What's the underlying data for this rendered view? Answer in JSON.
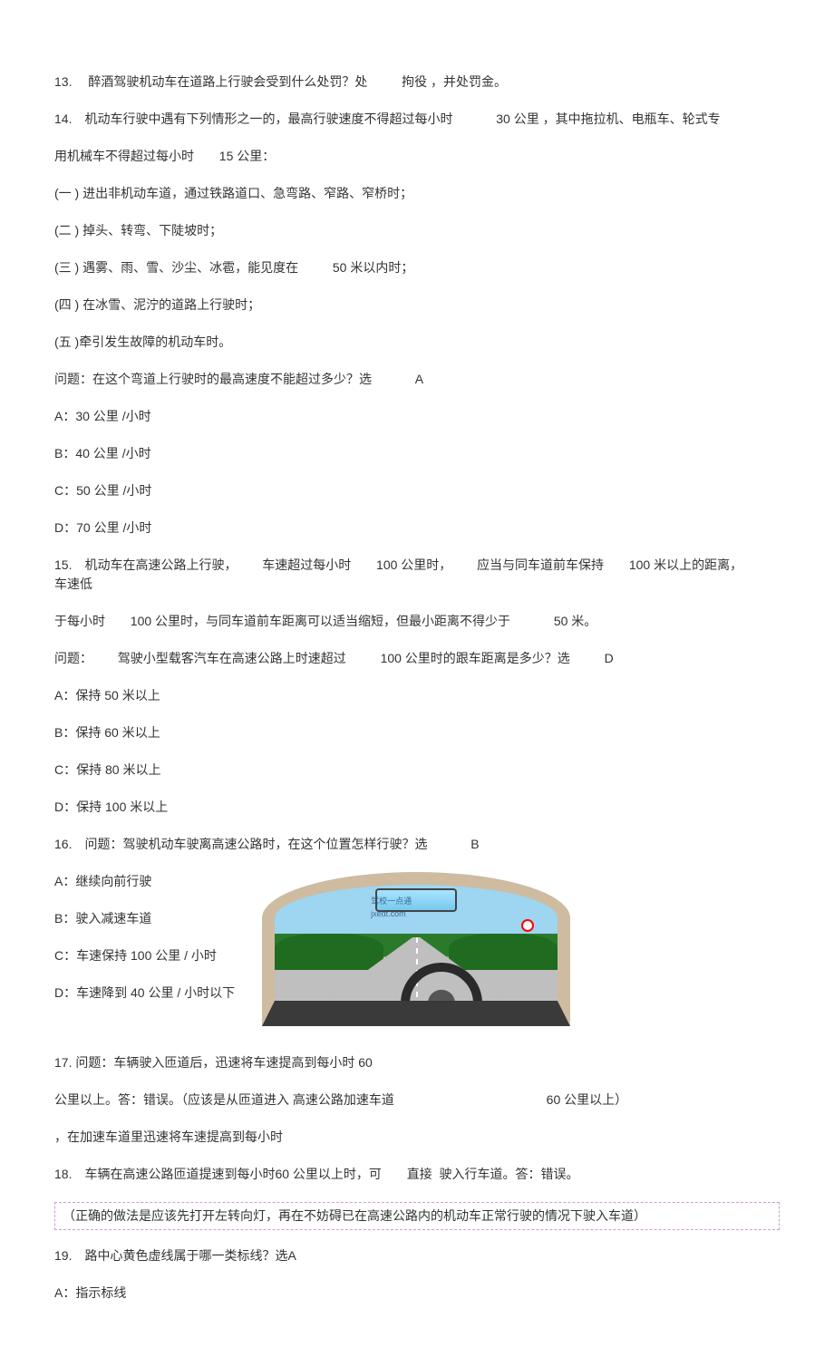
{
  "q13": {
    "pre": "13. 　醉酒驾驶机动车在道路上行驶会受到什么处罚？处",
    "bold": "拘役",
    "post": "，并处罚金。"
  },
  "q14": {
    "l1a": "14. 机动车行驶中遇有下列情形之一的，最高行驶速度不得超过每小时",
    "l1b": "30 公里",
    "l1c": "，其中拖拉机、电瓶车、轮式专",
    "l2a": "用机械车不得超过每小时",
    "l2b": "15 公里：",
    "p1": "(一 ) 进出非机动车道，通过铁路道口、急弯路、窄路、窄桥时；",
    "p2": "(二 ) 掉头、转弯、下陡坡时；",
    "p3a": "(三 ) 遇雾、雨、雪、沙尘、冰雹，能见度在",
    "p3b": "50 米以内时；",
    "p4": "(四 ) 在冰雪、泥泞的道路上行驶时；",
    "p5": "(五 )牵引发生故障的机动车时。",
    "q": "问题：在这个弯道上行驶时的最高速度不能超过多少？选",
    "ans": "A",
    "a": "A：30 公里 /小时",
    "b": "B：40 公里 /小时",
    "c": "C：50 公里 /小时",
    "d": "D：70 公里 /小时"
  },
  "q15": {
    "l1a": "15. 机动车在高速公路上行驶，",
    "l1b": "车速超过每小时",
    "l1c": "100 公里时，",
    "l1d": "应当与同车道前车保持",
    "l1e": "100 米以上的距离，",
    "l1f": "车速低",
    "l2a": "于每小时",
    "l2b": "100 公里时，与同车道前车距离可以适当缩短，但最小距离不得少于",
    "l2c": "50 米。",
    "q1": "问题：",
    "q2": "驾驶小型载客汽车在高速公路上时速超过",
    "q3": "100 公里时的跟车距离是多少？选",
    "ans": "D",
    "a": "A：保持    50 米以上",
    "b": "B：保持 60 米以上",
    "c": "C：保持 80 米以上",
    "d": "D：保持    100 米以上"
  },
  "q16": {
    "q": "16. 问题：驾驶机动车驶离高速公路时，在这个位置怎样行驶？选",
    "ans": "B",
    "a": "A：继续向前行驶",
    "b": "B：驶入减速车道",
    "c": "C：车速保持    100 公里 / 小时",
    "d": "D：车速降到    40 公里 / 小时以下",
    "wm1": "驾校一点通",
    "wm2": "jxedt.com"
  },
  "q17": {
    "l1": "17. 问题：车辆驶入匝道后，迅速将车速提高到每小时 60",
    "l2a": "公里以上。答：错误。（应该是从匝道进入 高速公路加速车道",
    "l2b": "60 公里以上）",
    "l3": "，在加速车道里迅速将车速提高到每小时"
  },
  "q18": {
    "l1a": "18. 车辆在高速公路匝道提速到每小时60 公里以上时，可",
    "l1b": "直接",
    "l1c": "驶入行车道。答：错误。",
    "note": "（正确的做法是应该先打开左转向灯，再在不妨碍已在高速公路内的机动车正常行驶的情况下驶入车道）"
  },
  "q19": {
    "q": "19. 路中心黄色虚线属于哪一类标线？选A",
    "a": "A：指示标线"
  }
}
